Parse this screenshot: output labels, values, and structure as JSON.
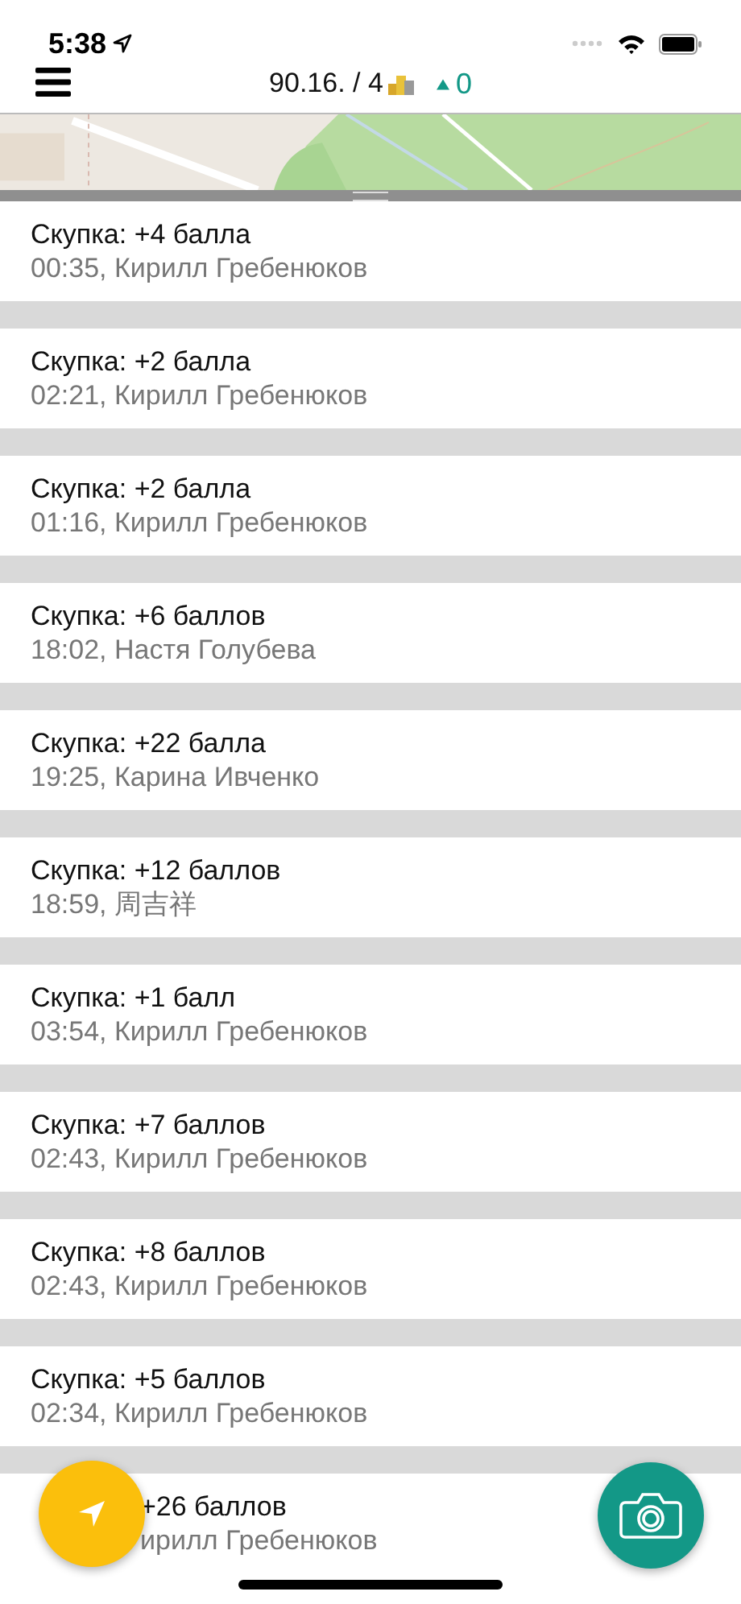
{
  "status_bar": {
    "time": "5:38"
  },
  "header": {
    "score": "90.16. / 4",
    "delta": "0"
  },
  "rows": [
    {
      "kind": "full",
      "title": "Скупка: +4 балла",
      "subtitle": "00:35, Кирилл Гребенюков"
    },
    {
      "kind": "full",
      "title": "Скупка: +2 балла",
      "subtitle": "02:21, Кирилл Гребенюков"
    },
    {
      "kind": "full",
      "title": "Скупка: +2 балла",
      "subtitle": "01:16, Кирилл Гребенюков"
    },
    {
      "kind": "full",
      "title": "Скупка: +6 баллов",
      "subtitle": "18:02, Настя Голубева"
    },
    {
      "kind": "full",
      "title": "Скупка: +22 балла",
      "subtitle": "19:25, Карина Ивченко"
    },
    {
      "kind": "full",
      "title": "Скупка: +12 баллов",
      "subtitle": "18:59, 周吉祥"
    },
    {
      "kind": "full",
      "title": "Скупка: +1 балл",
      "subtitle": "03:54, Кирилл Гребенюков"
    },
    {
      "kind": "full",
      "title": "Скупка: +7 баллов",
      "subtitle": "02:43, Кирилл Гребенюков"
    },
    {
      "kind": "full",
      "title": "Скупка: +8 баллов",
      "subtitle": "02:43, Кирилл Гребенюков"
    },
    {
      "kind": "full",
      "title": "Скупка: +5 баллов",
      "subtitle": "02:34, Кирилл Гребенюков"
    },
    {
      "kind": "covered",
      "title": "+26 баллов",
      "subtitle": "ирилл Гребенюков"
    }
  ]
}
